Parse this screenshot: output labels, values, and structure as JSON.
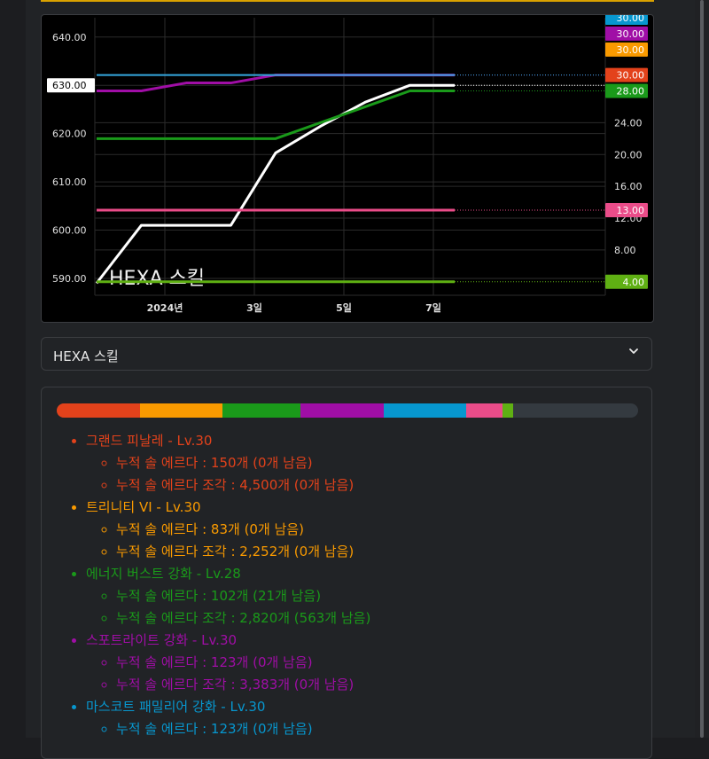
{
  "chart_data": {
    "type": "line",
    "annotation": "HEXA 스킬",
    "x_ticks": [
      "2024년",
      "3일",
      "5일",
      "7일"
    ],
    "left_axis": {
      "ticks": [
        "640.00",
        "630.00",
        "620.00",
        "610.00",
        "600.00",
        "590.00"
      ],
      "ylim": [
        586.5,
        644
      ],
      "current": "630.00"
    },
    "right_axis": {
      "ticks": [
        "24.00",
        "20.00",
        "16.00",
        "12.00",
        "8.00"
      ],
      "ylim": [
        2.3,
        37.2
      ]
    },
    "x": [
      "2023-12-31",
      "2024-01-01",
      "2024-01-02",
      "2024-01-03",
      "2024-01-04",
      "2024-01-05",
      "2024-01-06",
      "2024-01-07",
      "2024-01-08"
    ],
    "series": [
      {
        "color": "#ffffff",
        "axis": "left",
        "values": [
          589,
          601,
          601,
          601,
          616,
          621.5,
          626.5,
          630,
          630
        ]
      },
      {
        "color": "#a00ea6",
        "axis": "right",
        "values": [
          28,
          28,
          29,
          29,
          30,
          30,
          30,
          30,
          30
        ]
      },
      {
        "color": "#1a9a1a",
        "axis": "right",
        "values": [
          22,
          22,
          22,
          22,
          22,
          24,
          26,
          28,
          28
        ]
      },
      {
        "color": "#ea4c89",
        "axis": "right",
        "values": [
          13,
          13,
          13,
          13,
          13,
          13,
          13,
          13,
          13
        ]
      },
      {
        "color": "#5fb013",
        "axis": "right",
        "values": [
          4,
          4,
          4,
          4,
          4,
          4,
          4,
          4,
          4
        ]
      },
      {
        "color": "#35a8e0",
        "axis": "right",
        "values": [
          30,
          30,
          30,
          30,
          30,
          30,
          30,
          30,
          30
        ]
      }
    ],
    "value_badges": [
      {
        "text": "30.00",
        "color": "#0797cf",
        "value": 37.2
      },
      {
        "text": "30.00",
        "color": "#a00ea6",
        "value": 35.2
      },
      {
        "text": "30.00",
        "color": "#f99a00",
        "value": 33.2
      },
      {
        "text": "30.00",
        "color": "#e3421b",
        "value": 30
      },
      {
        "text": "28.00",
        "color": "#1a9a1a",
        "value": 28
      },
      {
        "text": "13.00",
        "color": "#ea4c89",
        "value": 13
      },
      {
        "text": "4.00",
        "color": "#5fb013",
        "value": 4
      }
    ]
  },
  "select": {
    "value": "HEXA 스킬",
    "icon": "chevron-down-icon"
  },
  "progress": [
    {
      "color": "#e3421b",
      "fraction": 0.1429
    },
    {
      "color": "#f99a00",
      "fraction": 0.1429
    },
    {
      "color": "#1a9a1a",
      "fraction": 0.1333
    },
    {
      "color": "#a00ea6",
      "fraction": 0.1429
    },
    {
      "color": "#0797cf",
      "fraction": 0.1429
    },
    {
      "color": "#ea4c89",
      "fraction": 0.0619
    },
    {
      "color": "#5fb013",
      "fraction": 0.019
    }
  ],
  "skills": [
    {
      "color": "#e3421b",
      "name": "그랜드 피날레 - Lv.30",
      "items": [
        "누적 솔 에르다 : 150개 (0개 남음)",
        "누적 솔 에르다 조각 : 4,500개 (0개 남음)"
      ]
    },
    {
      "color": "#f99a00",
      "name": "트리니티 VI - Lv.30",
      "items": [
        "누적 솔 에르다 : 83개 (0개 남음)",
        "누적 솔 에르다 조각 : 2,252개 (0개 남음)"
      ]
    },
    {
      "color": "#1a9a1a",
      "name": "에너지 버스트 강화 - Lv.28",
      "items": [
        "누적 솔 에르다 : 102개 (21개 남음)",
        "누적 솔 에르다 조각 : 2,820개 (563개 남음)"
      ]
    },
    {
      "color": "#a00ea6",
      "name": "스포트라이트 강화 - Lv.30",
      "items": [
        "누적 솔 에르다 : 123개 (0개 남음)",
        "누적 솔 에르다 조각 : 3,383개 (0개 남음)"
      ]
    },
    {
      "color": "#0797cf",
      "name": "마스코트 패밀리어 강화 - Lv.30",
      "items": [
        "누적 솔 에르다 : 123개 (0개 남음)"
      ]
    }
  ]
}
